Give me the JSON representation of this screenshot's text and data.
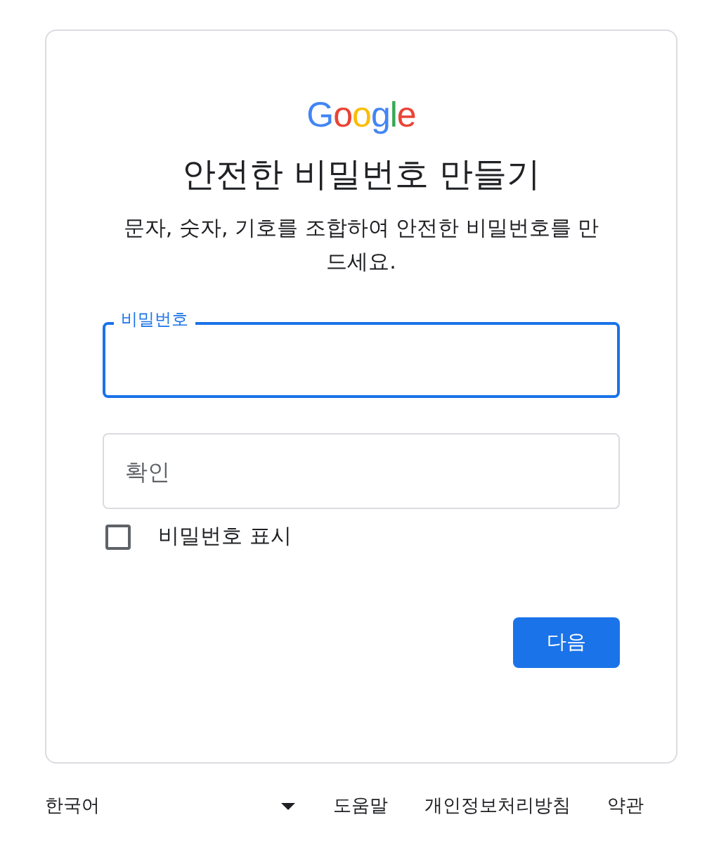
{
  "logo": "Google",
  "title": "안전한 비밀번호 만들기",
  "subtitle": "문자, 숫자, 기호를 조합하여 안전한 비밀번호를 만드세요.",
  "password_field": {
    "label": "비밀번호",
    "focused": true
  },
  "confirm_field": {
    "placeholder": "확인",
    "focused": false
  },
  "show_password": {
    "label": "비밀번호 표시",
    "checked": false
  },
  "next_button": "다음",
  "footer": {
    "language": "한국어",
    "links": [
      "도움말",
      "개인정보처리방침",
      "약관"
    ]
  }
}
